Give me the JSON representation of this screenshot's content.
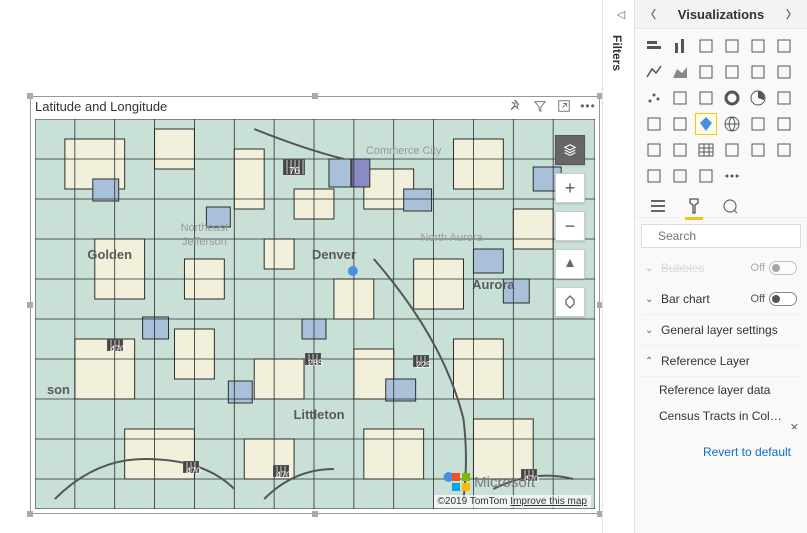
{
  "visual": {
    "title": "Latitude and Longitude",
    "attribution_prefix": "©2019 TomTom ",
    "attribution_link": "Improve this map",
    "logo_text": "Microsoft"
  },
  "map_labels": {
    "denver": "Denver",
    "golden": "Golden",
    "aurora": "Aurora",
    "littleton": "Littleton",
    "commerce_city": "Commerce City",
    "north_aurora": "North Aurora",
    "ne_jefferson1": "Northeast",
    "ne_jefferson2": "Jefferson",
    "son": "son"
  },
  "highways": {
    "r470": "470",
    "r76": "76",
    "r285": "285",
    "r225": "225"
  },
  "filters": {
    "label": "Filters"
  },
  "pane": {
    "title": "Visualizations",
    "search_placeholder": "Search",
    "cutoff_label": "Bubbles",
    "cutoff_state_off": "Off",
    "bar_chart": "Bar chart",
    "bar_chart_state": "Off",
    "general_layer": "General layer settings",
    "reference_layer": "Reference Layer",
    "reference_layer_data": "Reference layer data",
    "census_tracts": "Census Tracts in Colorado...",
    "revert": "Revert to default"
  },
  "gallery_icons": [
    "stacked-bar",
    "stacked-column",
    "clustered-bar",
    "clustered-column",
    "stacked-bar-100",
    "stacked-column-100",
    "line",
    "area",
    "stacked-area",
    "line-column",
    "ribbon",
    "waterfall",
    "scatter",
    "funnel",
    "treemap",
    "donut",
    "pie",
    "gauge",
    "card",
    "multi-card",
    "azure-map",
    "arcgis-map",
    "kpi",
    "slicer",
    "filled-map",
    "shape-map",
    "table",
    "matrix",
    "r-visual",
    "python-visual",
    "qna",
    "key-influencers",
    "decomposition",
    "more"
  ],
  "selected_gallery_index": 20,
  "tabs": [
    "fields",
    "format",
    "analytics"
  ],
  "active_tab": 1
}
